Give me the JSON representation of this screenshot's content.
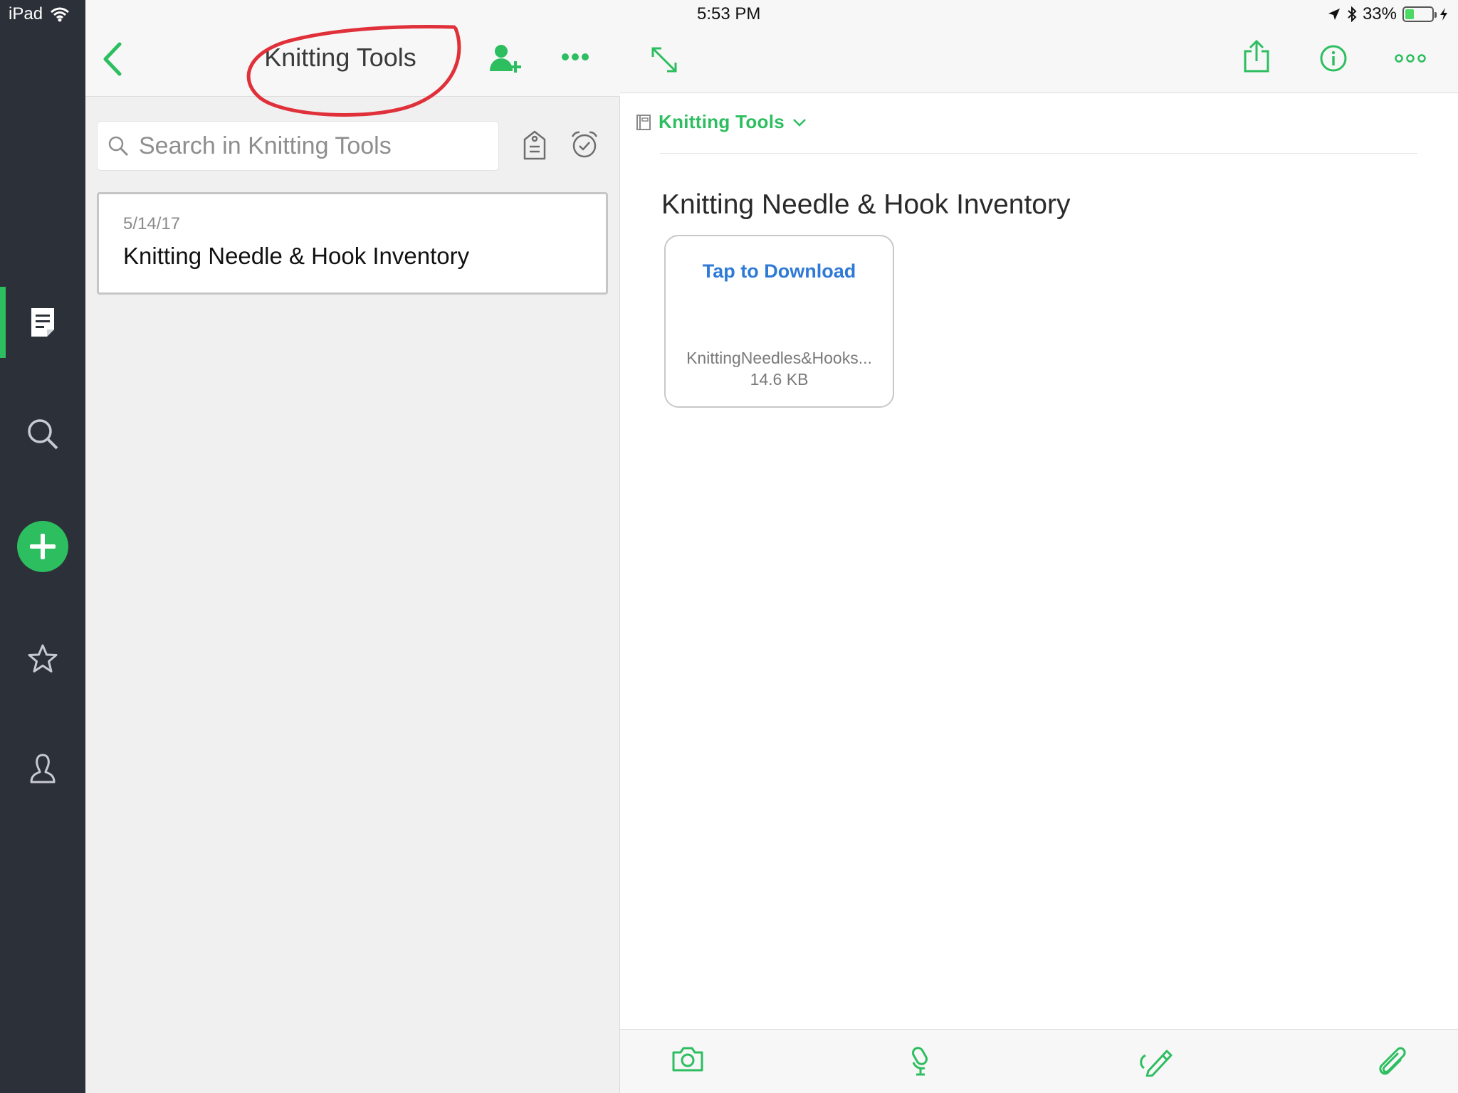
{
  "status_bar": {
    "device": "iPad",
    "time": "5:53 PM",
    "battery": "33%",
    "battery_level": 0.33
  },
  "sidebar": {
    "items": [
      {
        "name": "notes",
        "icon": "note-icon",
        "active": true
      },
      {
        "name": "search",
        "icon": "search-icon",
        "active": false
      },
      {
        "name": "new-note",
        "icon": "plus-icon",
        "active": false
      },
      {
        "name": "shortcuts",
        "icon": "star-icon",
        "active": false
      },
      {
        "name": "account",
        "icon": "person-icon",
        "active": false
      }
    ]
  },
  "notebook_pane": {
    "title": "Knitting Tools",
    "search": {
      "placeholder": "Search in Knitting Tools",
      "value": ""
    },
    "notes": [
      {
        "date": "5/14/17",
        "title": "Knitting Needle & Hook Inventory"
      }
    ]
  },
  "note_view": {
    "notebook_selector": "Knitting Tools",
    "title": "Knitting Needle & Hook Inventory",
    "attachment": {
      "action": "Tap to Download",
      "filename": "KnittingNeedles&Hooks...",
      "size": "14.6 KB"
    }
  },
  "colors": {
    "accent": "#2dbe60",
    "sidebar": "#2c3039",
    "link": "#2e7ad6",
    "annotation": "#e0313b"
  }
}
